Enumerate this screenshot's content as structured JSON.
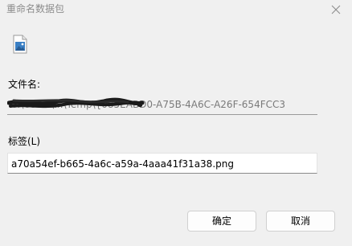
{
  "window": {
    "title": "重命名数据包"
  },
  "icons": {
    "close": "close-icon",
    "file": "image-file-icon"
  },
  "filename": {
    "label": "文件名:",
    "value": "C:\\Users\\...\\Temp\\{085EABD0-A75B-4A6C-A26F-654FCC3"
  },
  "tag": {
    "label": "标签(L)",
    "value": "a70a54ef-b665-4a6c-a59a-4aaa41f31a38.png"
  },
  "buttons": {
    "ok": "确定",
    "cancel": "取消"
  },
  "colors": {
    "background": "#f0f0f0",
    "title_text": "#8c8c8c",
    "field_bg": "#ffffff",
    "redaction": "#1a1a1a"
  }
}
